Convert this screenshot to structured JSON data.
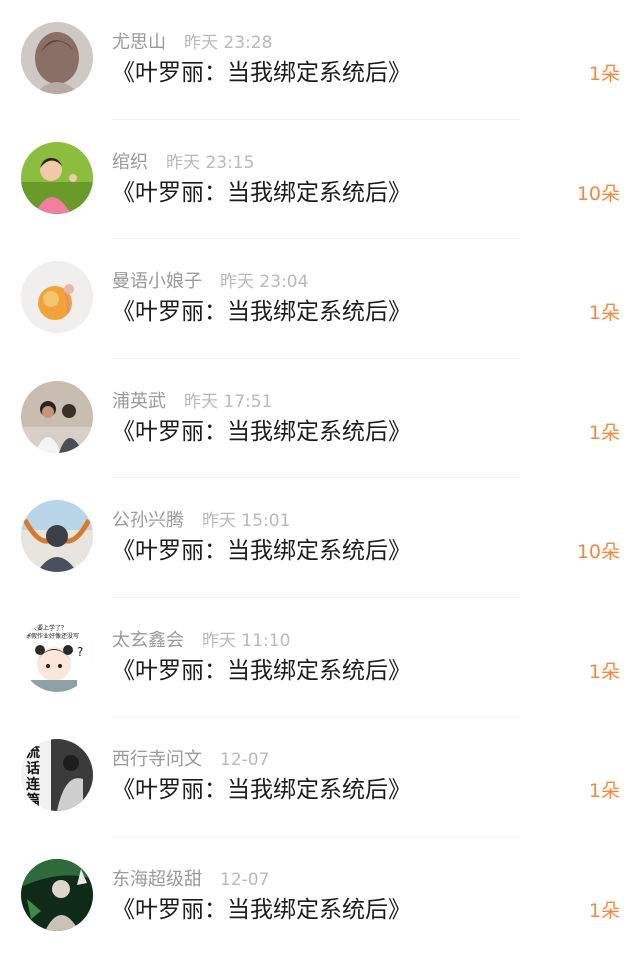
{
  "rows": [
    {
      "name": "尤思山",
      "time": "昨天 23:28",
      "title": "《叶罗丽：当我绑定系统后》",
      "count": "1朵"
    },
    {
      "name": "绾织",
      "time": "昨天 23:15",
      "title": "《叶罗丽：当我绑定系统后》",
      "count": "10朵"
    },
    {
      "name": "曼语小娘子",
      "time": "昨天 23:04",
      "title": "《叶罗丽：当我绑定系统后》",
      "count": "1朵"
    },
    {
      "name": "浦英武",
      "time": "昨天 17:51",
      "title": "《叶罗丽：当我绑定系统后》",
      "count": "1朵"
    },
    {
      "name": "公孙兴腾",
      "time": "昨天 15:01",
      "title": "《叶罗丽：当我绑定系统后》",
      "count": "10朵"
    },
    {
      "name": "太玄鑫会",
      "time": "昨天 11:10",
      "title": "《叶罗丽：当我绑定系统后》",
      "count": "1朵"
    },
    {
      "name": "西行寺问文",
      "time": "12-07",
      "title": "《叶罗丽：当我绑定系统后》",
      "count": "1朵"
    },
    {
      "name": "东海超级甜",
      "time": "12-07",
      "title": "《叶罗丽：当我绑定系统后》",
      "count": "1朵"
    }
  ],
  "avatars": {
    "row6_text": [
      "今天要上学了？",
      "寒假作业好像还没写"
    ],
    "row7_text": [
      "流",
      "话",
      "连",
      "篇"
    ]
  },
  "colors": {
    "accent": "#f08a43",
    "name": "#9a9a9a",
    "time": "#b9b9b9",
    "title": "#1c1c1c"
  }
}
